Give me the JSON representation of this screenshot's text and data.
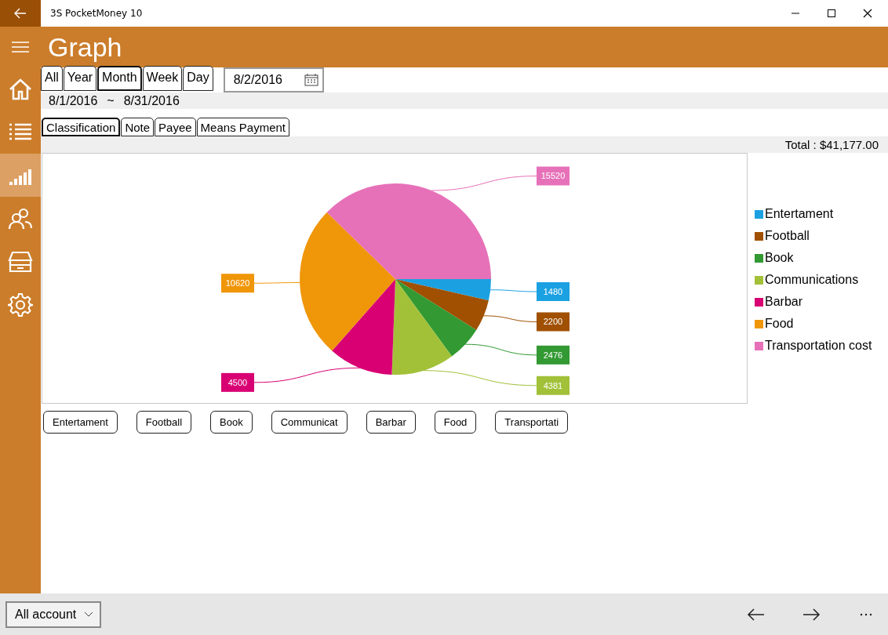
{
  "window": {
    "title": "3S PocketMoney 10"
  },
  "header": {
    "title": "Graph"
  },
  "sidebar": {
    "items": [
      {
        "selected": false
      },
      {
        "selected": false
      },
      {
        "selected": true
      },
      {
        "selected": false
      },
      {
        "selected": false
      },
      {
        "selected": false
      }
    ]
  },
  "period_tabs": [
    {
      "label": "All",
      "selected": false
    },
    {
      "label": "Year",
      "selected": false
    },
    {
      "label": "Month",
      "selected": true
    },
    {
      "label": "Week",
      "selected": false
    },
    {
      "label": "Day",
      "selected": false
    }
  ],
  "date_field": {
    "value": "8/2/2016"
  },
  "range": {
    "start": "8/1/2016",
    "separator": "~",
    "end": "8/31/2016"
  },
  "group_tabs": [
    {
      "label": "Classification",
      "selected": true
    },
    {
      "label": "Note",
      "selected": false
    },
    {
      "label": "Payee",
      "selected": false
    },
    {
      "label": "Means Payment",
      "selected": false
    }
  ],
  "total": "Total : $41,177.00",
  "chart_data": {
    "type": "pie",
    "data_labels": true,
    "legend": "right",
    "categories": [
      "Entertament",
      "Football",
      "Book",
      "Communications",
      "Barbar",
      "Food",
      "Transportation cost"
    ],
    "values": [
      1480,
      2200,
      2476,
      4381,
      4500,
      10620,
      15520
    ],
    "colors": [
      "#1ba1e2",
      "#a05000",
      "#339933",
      "#a2c139",
      "#d80073",
      "#f09609",
      "#e671b8"
    ]
  },
  "filter_buttons": [
    "Entertament",
    "Football",
    "Book",
    "Communicat",
    "Barbar",
    "Food",
    "Transportati"
  ],
  "bottom_bar": {
    "account_select": {
      "value": "All account"
    }
  }
}
